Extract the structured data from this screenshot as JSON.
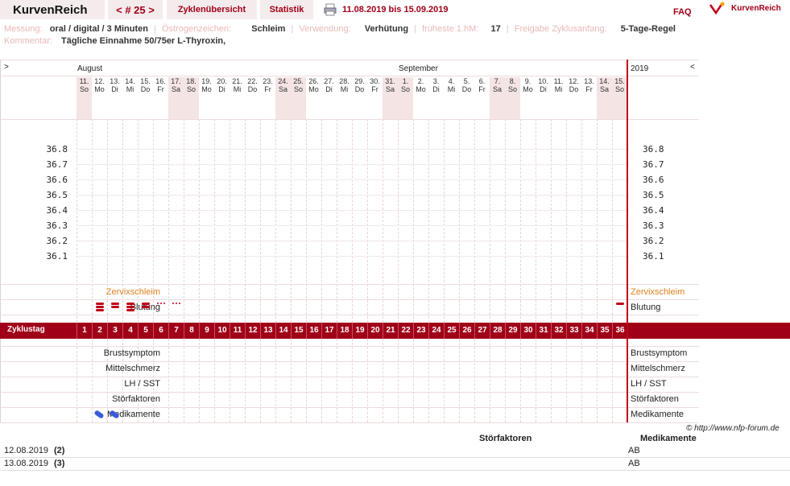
{
  "header": {
    "brand": "KurvenReich",
    "cycle_nav": "< # 25 >",
    "tab_overview": "Zyklenübersicht",
    "tab_stats": "Statistik",
    "date_range": "11.08.2019 bis 15.09.2019",
    "faq": "FAQ",
    "logo_text": "KurvenReich"
  },
  "info": {
    "messung_label": "Messung:",
    "messung_value": "oral / digital / 3 Minuten",
    "oestrogen_label": "Östrogenzeichen:",
    "oestrogen_value": "Schleim",
    "verwendung_label": "Verwendung:",
    "verwendung_value": "Verhütung",
    "fruehest_label": "früheste 1.hM:",
    "fruehest_value": "17",
    "freigabe_label": "Freigabe Zyklusanfang:",
    "freigabe_value": "5-Tage-Regel",
    "kommentar_label": "Kommentar:",
    "kommentar_value": "Tägliche Einnahme 50/75er L-Thyroxin,"
  },
  "chart": {
    "nav_left": ">",
    "nav_right": "<",
    "month1": "August",
    "month2": "September",
    "year": "2019",
    "days": [
      {
        "d": "11.",
        "w": "So",
        "we": true
      },
      {
        "d": "12.",
        "w": "Mo",
        "we": false
      },
      {
        "d": "13.",
        "w": "Di",
        "we": false
      },
      {
        "d": "14.",
        "w": "Mi",
        "we": false
      },
      {
        "d": "15.",
        "w": "Do",
        "we": false
      },
      {
        "d": "16.",
        "w": "Fr",
        "we": false
      },
      {
        "d": "17.",
        "w": "Sa",
        "we": true
      },
      {
        "d": "18.",
        "w": "So",
        "we": true
      },
      {
        "d": "19.",
        "w": "Mo",
        "we": false
      },
      {
        "d": "20.",
        "w": "Di",
        "we": false
      },
      {
        "d": "21.",
        "w": "Mi",
        "we": false
      },
      {
        "d": "22.",
        "w": "Do",
        "we": false
      },
      {
        "d": "23.",
        "w": "Fr",
        "we": false
      },
      {
        "d": "24.",
        "w": "Sa",
        "we": true
      },
      {
        "d": "25.",
        "w": "So",
        "we": true
      },
      {
        "d": "26.",
        "w": "Mo",
        "we": false
      },
      {
        "d": "27.",
        "w": "Di",
        "we": false
      },
      {
        "d": "28.",
        "w": "Mi",
        "we": false
      },
      {
        "d": "29.",
        "w": "Do",
        "we": false
      },
      {
        "d": "30.",
        "w": "Fr",
        "we": false
      },
      {
        "d": "31.",
        "w": "Sa",
        "we": true
      },
      {
        "d": "1.",
        "w": "So",
        "we": true
      },
      {
        "d": "2.",
        "w": "Mo",
        "we": false
      },
      {
        "d": "3.",
        "w": "Di",
        "we": false
      },
      {
        "d": "4.",
        "w": "Mi",
        "we": false
      },
      {
        "d": "5.",
        "w": "Do",
        "we": false
      },
      {
        "d": "6.",
        "w": "Fr",
        "we": false
      },
      {
        "d": "7.",
        "w": "Sa",
        "we": true
      },
      {
        "d": "8.",
        "w": "So",
        "we": true
      },
      {
        "d": "9.",
        "w": "Mo",
        "we": false
      },
      {
        "d": "10.",
        "w": "Di",
        "we": false
      },
      {
        "d": "11.",
        "w": "Mi",
        "we": false
      },
      {
        "d": "12.",
        "w": "Do",
        "we": false
      },
      {
        "d": "13.",
        "w": "Fr",
        "we": false
      },
      {
        "d": "14.",
        "w": "Sa",
        "we": true
      },
      {
        "d": "15.",
        "w": "So",
        "we": true
      }
    ],
    "temps": [
      "36.8",
      "36.7",
      "36.6",
      "36.5",
      "36.4",
      "36.3",
      "36.2",
      "36.1"
    ],
    "row_zervix": "Zervixschleim",
    "row_blutung": "Blutung",
    "row_zyklustag": "Zyklustag",
    "cycle_days": [
      "1",
      "2",
      "3",
      "4",
      "5",
      "6",
      "7",
      "8",
      "9",
      "10",
      "11",
      "12",
      "13",
      "14",
      "15",
      "16",
      "17",
      "18",
      "19",
      "20",
      "21",
      "22",
      "23",
      "24",
      "25",
      "26",
      "27",
      "28",
      "29",
      "30",
      "31",
      "32",
      "33",
      "34",
      "35",
      "36"
    ],
    "bleeding": [
      0,
      3,
      2,
      3,
      2,
      1,
      1,
      0,
      0,
      0,
      0,
      0,
      0,
      0,
      0,
      0,
      0,
      0,
      0,
      0,
      0,
      0,
      0,
      0,
      0,
      0,
      0,
      0,
      0,
      0,
      0,
      0,
      0,
      0,
      0,
      4
    ],
    "row_brust": "Brustsymptom",
    "row_mittel": "Mittelschmerz",
    "row_lh": "LH / SST",
    "row_stoer": "Störfaktoren",
    "row_medi": "Medikamente",
    "medication_days": [
      2,
      3
    ],
    "credit": "© http://www.nfp-forum.de"
  },
  "notes_table": {
    "col_stoer": "Störfaktoren",
    "col_medi": "Medikamente",
    "rows": [
      {
        "date": "12.08.2019",
        "day": "(2)",
        "medi": "AB"
      },
      {
        "date": "13.08.2019",
        "day": "(3)",
        "medi": "AB"
      }
    ]
  }
}
